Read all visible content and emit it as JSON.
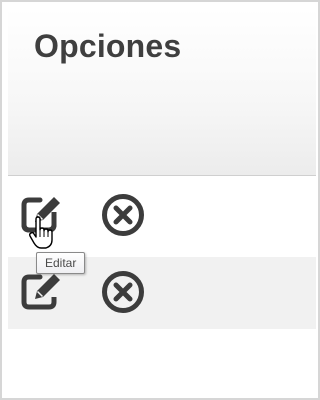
{
  "header": {
    "title": "Opciones"
  },
  "rows": [
    {
      "edit_icon": "edit-icon",
      "delete_icon": "close-circle-icon"
    },
    {
      "edit_icon": "edit-icon",
      "delete_icon": "close-circle-icon"
    }
  ],
  "tooltip": {
    "text": "Editar"
  },
  "colors": {
    "icon": "#3c3c3c",
    "title": "#3f3f3f",
    "row_alt_bg": "#f1f1f1",
    "frame_border": "#d6d6d6"
  }
}
